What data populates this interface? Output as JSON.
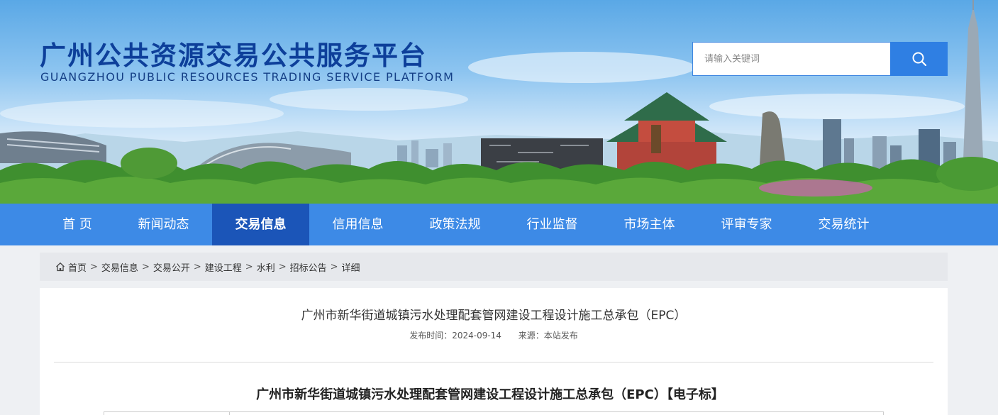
{
  "header": {
    "title_cn": "广州公共资源交易公共服务平台",
    "title_en": "GUANGZHOU PUBLIC RESOURCES TRADING SERVICE PLATFORM",
    "search": {
      "placeholder": "请输入关键词",
      "value": "",
      "icon": "search-icon"
    }
  },
  "nav": {
    "items": [
      {
        "label": "首 页"
      },
      {
        "label": "新闻动态"
      },
      {
        "label": "交易信息",
        "active": true
      },
      {
        "label": "信用信息"
      },
      {
        "label": "政策法规"
      },
      {
        "label": "行业监督"
      },
      {
        "label": "市场主体"
      },
      {
        "label": "评审专家"
      },
      {
        "label": "交易统计"
      }
    ]
  },
  "breadcrumb": {
    "icon": "home-icon",
    "items": [
      "首页",
      "交易信息",
      "交易公开",
      "建设工程",
      "水利",
      "招标公告",
      "详细"
    ],
    "separator": ">"
  },
  "article": {
    "title": "广州市新华街道城镇污水处理配套管网建设工程设计施工总承包（EPC）",
    "publish_time": "发布时间：2024-09-14",
    "source": "来源：本站发布",
    "subtitle": "广州市新华街道城镇污水处理配套管网建设工程设计施工总承包（EPC）【电子标】"
  },
  "colors": {
    "nav_bg": "#3d8ae6",
    "nav_active": "#1b55b8",
    "logo": "#0d3f9a",
    "search_button": "#2f7fe3"
  }
}
